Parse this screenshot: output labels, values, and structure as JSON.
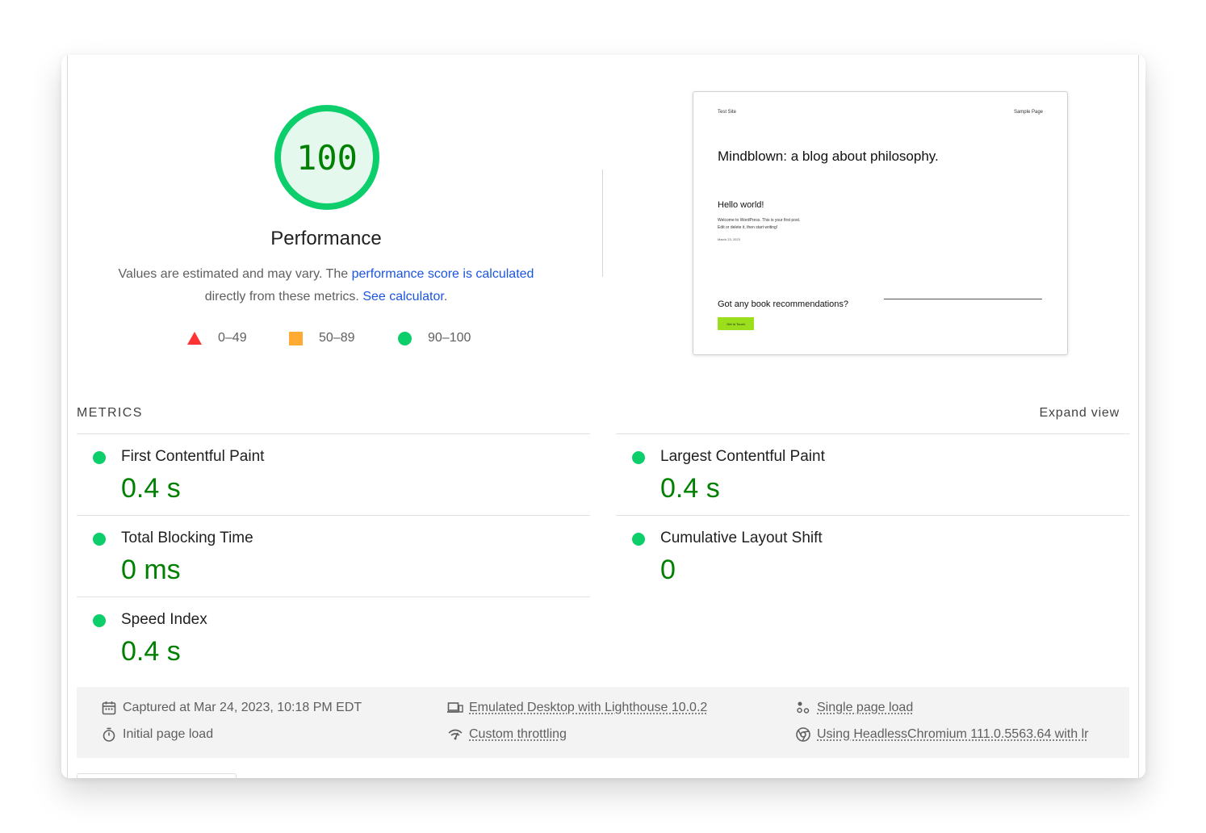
{
  "gauge": {
    "score": "100",
    "score_fraction": 1.0,
    "label": "Performance",
    "desc_text_1": "Values are estimated and may vary. The ",
    "desc_link_1": "performance score is calculated",
    "desc_text_2": " directly from these metrics. ",
    "desc_link_2": "See calculator",
    "desc_text_3": ".",
    "colors": {
      "pass": "#0cce6b",
      "pass_text": "#008000",
      "pass_bg": "#e5f8ee"
    }
  },
  "legend": [
    {
      "shape": "triangle",
      "range": "0–49",
      "color": "#ff3333"
    },
    {
      "shape": "square",
      "range": "50–89",
      "color": "#ffaa33"
    },
    {
      "shape": "circle",
      "range": "90–100",
      "color": "#0cce6b"
    }
  ],
  "thumbnail": {
    "site_title": "Test Site",
    "nav_link": "Sample Page",
    "heading": "Mindblown: a blog about philosophy.",
    "post_title": "Hello world!",
    "post_line_1": "Welcome to WordPress. This is your first post.",
    "post_line_2": "Edit or delete it, then start writing!",
    "post_date": "March 23, 2023",
    "cta_text": "Got any book recommendations?",
    "cta_button": "Get In Touch"
  },
  "metrics": {
    "title": "METRICS",
    "expand_label": "Expand view",
    "items": [
      {
        "label": "First Contentful Paint",
        "value": "0.4 s"
      },
      {
        "label": "Largest Contentful Paint",
        "value": "0.4 s"
      },
      {
        "label": "Total Blocking Time",
        "value": "0 ms"
      },
      {
        "label": "Cumulative Layout Shift",
        "value": "0"
      },
      {
        "label": "Speed Index",
        "value": "0.4 s"
      }
    ]
  },
  "footer": {
    "captured": "Captured at Mar 24, 2023, 10:18 PM EDT",
    "initial_load": "Initial page load",
    "emulated": "Emulated Desktop with Lighthouse 10.0.2",
    "throttling": "Custom throttling",
    "single_load": "Single page load",
    "browser": "Using HeadlessChromium 111.0.5563.64 with lr"
  }
}
